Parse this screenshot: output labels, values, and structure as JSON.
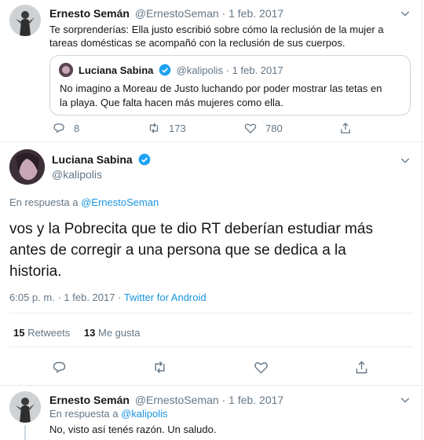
{
  "tweet1": {
    "author_name": "Ernesto Semán",
    "handle": "@ErnestoSeman",
    "separator": "·",
    "date": "1 feb. 2017",
    "text_line1": "Te sorprenderías: Ella justo escribió sobre cómo la reclusión de la mujer a",
    "text_line2": "tareas domésticas se acompañó con la reclusión de sus cuerpos.",
    "quote": {
      "author_name": "Luciana Sabina",
      "handle": "@kalipolis",
      "separator": "·",
      "date": "1 feb. 2017",
      "text_line1": "No imagino a Moreau de Justo luchando por poder mostrar las tetas en",
      "text_line2": "la playa. Que falta hacen más mujeres como ella."
    },
    "replies": "8",
    "retweets": "173",
    "likes": "780"
  },
  "main_tweet": {
    "author_name": "Luciana Sabina",
    "handle": "@kalipolis",
    "reply_prefix": "En respuesta a",
    "reply_to": "@ErnestoSeman",
    "text_line1": "vos y la Pobrecita que te dio RT deberían estudiar más",
    "text_line2": "antes de corregir a una persona que se dedica a la",
    "text_line3": "historia.",
    "time": "6:05 p. m.",
    "separator": "·",
    "date": "1 feb. 2017",
    "source": "Twitter for Android",
    "retweet_count": "15",
    "retweet_label": "Retweets",
    "like_count": "13",
    "like_label": "Me gusta"
  },
  "tweet3": {
    "author_name": "Ernesto Semán",
    "handle": "@ErnestoSeman",
    "separator": "·",
    "date": "1 feb. 2017",
    "reply_prefix": "En respuesta a",
    "reply_to": "@kalipolis",
    "text": "No, visto así tenés razón. Un saludo."
  },
  "colors": {
    "accent": "#1da1f2",
    "link": "#1b95e0",
    "secondary_text": "#657786",
    "border": "#e6ecf0"
  },
  "icons": [
    "chevron-down-icon",
    "reply-icon",
    "retweet-icon",
    "like-icon",
    "share-icon",
    "verified-badge-icon"
  ]
}
